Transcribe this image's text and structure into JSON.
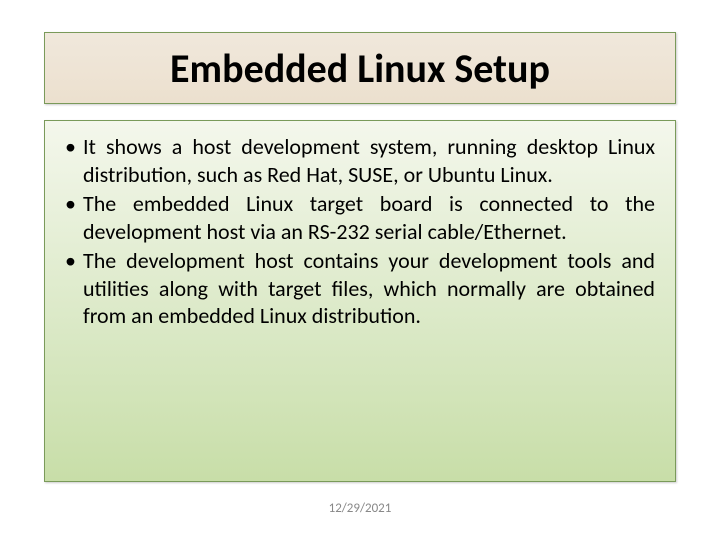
{
  "title": "Embedded Linux Setup",
  "bullets": [
    "It shows a host development system, running desktop Linux distribution, such as Red Hat, SUSE, or Ubuntu Linux.",
    "The embedded Linux target board is connected to the development host via an RS-232 serial cable/Ethernet.",
    "The development host contains your development tools and utilities along with target files, which normally are obtained from an embedded Linux distribution."
  ],
  "footer_date": "12/29/2021"
}
